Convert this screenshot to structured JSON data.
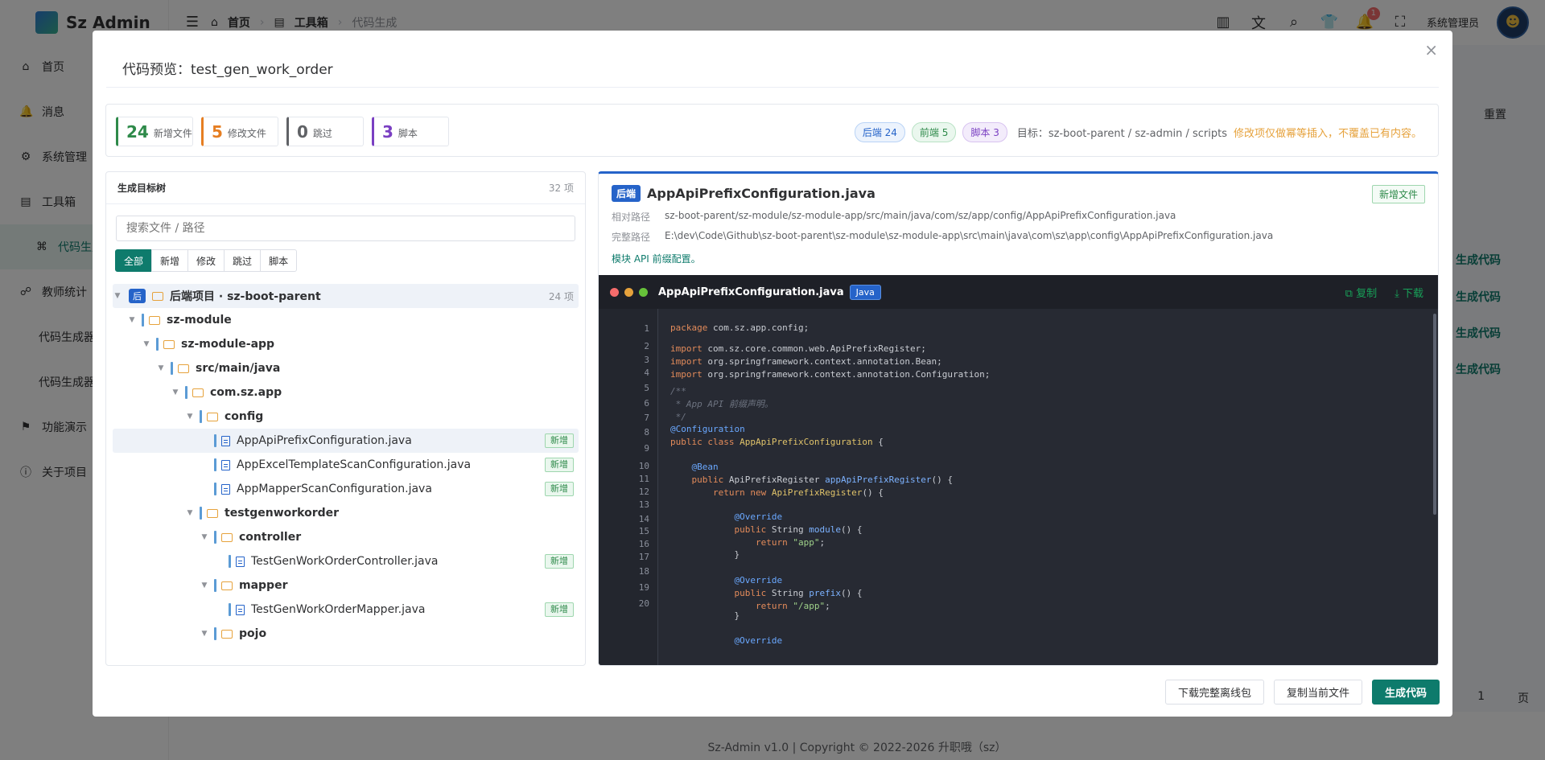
{
  "app": {
    "name": "Sz Admin",
    "menu": [
      {
        "label": "首页",
        "icon": "home-icon"
      },
      {
        "label": "消息",
        "icon": "bell-icon"
      },
      {
        "label": "系统管理",
        "icon": "gear-icon"
      },
      {
        "label": "工具箱",
        "icon": "toolbox-icon"
      },
      {
        "label": "代码生成",
        "icon": "code-icon"
      },
      {
        "label": "教师统计",
        "icon": "chart-icon"
      },
      {
        "label": "代码生成器",
        "icon": ""
      },
      {
        "label": "代码生成器",
        "icon": ""
      },
      {
        "label": "功能演示",
        "icon": "flag-icon"
      },
      {
        "label": "关于项目",
        "icon": "info-icon"
      }
    ],
    "breadcrumb": [
      "首页",
      "工具箱",
      "代码生成"
    ],
    "notice_count": "1",
    "user_name": "系统管理员",
    "bg_reset": "重置",
    "bg_gen_label": "生成代码",
    "bg_page": "1",
    "bg_page_unit": "页",
    "footer": "Sz-Admin v1.0 | Copyright © 2022-2026 升职哦（sz）"
  },
  "dialog": {
    "title": "代码预览：test_gen_work_order",
    "summary": {
      "stats": [
        {
          "num": "24",
          "label": "新增文件",
          "color": "#2e8a4a"
        },
        {
          "num": "5",
          "label": "修改文件",
          "color": "#e67e22"
        },
        {
          "num": "0",
          "label": "跳过",
          "color": "#606266"
        },
        {
          "num": "3",
          "label": "脚本",
          "color": "#7a3fc2"
        }
      ],
      "pill_backend": "后端 24",
      "pill_frontend": "前端 5",
      "pill_script": "脚本 3",
      "target": "目标：sz-boot-parent / sz-admin / scripts",
      "warning": "修改项仅做幂等插入，不覆盖已有内容。"
    },
    "tree": {
      "title": "生成目标树",
      "count": "32 项",
      "search_placeholder": "搜索文件 / 路径",
      "filters": [
        "全部",
        "新增",
        "修改",
        "跳过",
        "脚本"
      ],
      "root_badge": "后",
      "root_label": "后端项目 · sz-boot-parent",
      "root_count": "24 项",
      "nodes": [
        {
          "label": "sz-module",
          "type": "folder",
          "depth": 1,
          "bold": true
        },
        {
          "label": "sz-module-app",
          "type": "folder",
          "depth": 2,
          "bold": true
        },
        {
          "label": "src/main/java",
          "type": "folder",
          "depth": 3,
          "bold": true
        },
        {
          "label": "com.sz.app",
          "type": "folder",
          "depth": 4,
          "bold": true
        },
        {
          "label": "config",
          "type": "folder",
          "depth": 5,
          "bold": true
        },
        {
          "label": "AppApiPrefixConfiguration.java",
          "type": "file",
          "depth": 6,
          "tag": "新增",
          "selected": true
        },
        {
          "label": "AppExcelTemplateScanConfiguration.java",
          "type": "file",
          "depth": 6,
          "tag": "新增"
        },
        {
          "label": "AppMapperScanConfiguration.java",
          "type": "file",
          "depth": 6,
          "tag": "新增"
        },
        {
          "label": "testgenworkorder",
          "type": "folder",
          "depth": 5,
          "bold": true
        },
        {
          "label": "controller",
          "type": "folder",
          "depth": 6,
          "bold": true
        },
        {
          "label": "TestGenWorkOrderController.java",
          "type": "file",
          "depth": 7,
          "tag": "新增"
        },
        {
          "label": "mapper",
          "type": "folder",
          "depth": 6,
          "bold": true
        },
        {
          "label": "TestGenWorkOrderMapper.java",
          "type": "file",
          "depth": 7,
          "tag": "新增"
        },
        {
          "label": "pojo",
          "type": "folder",
          "depth": 6,
          "bold": true
        }
      ]
    },
    "preview": {
      "badge": "后端",
      "file_name": "AppApiPrefixConfiguration.java",
      "status": "新增文件",
      "rel_label": "相对路径",
      "rel_path": "sz-boot-parent/sz-module/sz-module-app/src/main/java/com/sz/app/config/AppApiPrefixConfiguration.java",
      "abs_label": "完整路径",
      "abs_path": "E:\\dev\\Code\\Github\\sz-boot-parent\\sz-module\\sz-module-app\\src\\main\\java\\com\\sz\\app\\config\\AppApiPrefixConfiguration.java",
      "desc": "模块 API 前缀配置。",
      "code_file": "AppApiPrefixConfiguration.java",
      "lang": "Java",
      "copy": "复制",
      "download": "下载",
      "lines": [
        {
          "n": "1",
          "html": "<span class=\"kw\">package</span> com.sz.app.config;"
        },
        {
          "n": "2",
          "html": "<span class=\"kw\">import</span> com.sz.core.common.web.ApiPrefixRegister;"
        },
        {
          "n": "3",
          "html": "<span class=\"kw\">import</span> org.springframework.context.annotation.Bean;"
        },
        {
          "n": "4",
          "html": "<span class=\"kw\">import</span> org.springframework.context.annotation.Configuration;"
        },
        {
          "n": "5",
          "html": "<span class=\"cm\">/**</span>"
        },
        {
          "n": "6",
          "html": "<span class=\"cm\"> * App API 前缀声明。</span>"
        },
        {
          "n": "7",
          "html": "<span class=\"cm\"> */</span>"
        },
        {
          "n": "8",
          "html": "<span class=\"an\">@Configuration</span>"
        },
        {
          "n": "8",
          "html": "<span class=\"kw\">public class</span> <span class=\"ty\">AppApiPrefixConfiguration</span> {"
        },
        {
          "n": "9",
          "html": ""
        },
        {
          "n": "9",
          "html": "    <span class=\"an\">@Bean</span>"
        },
        {
          "n": "10",
          "html": "    <span class=\"kw\">public</span> ApiPrefixRegister <span class=\"fn\">appApiPrefixRegister</span>() {"
        },
        {
          "n": "11",
          "html": "        <span class=\"kw\">return new</span> <span class=\"ty\">ApiPrefixRegister</span>() {"
        },
        {
          "n": "12",
          "html": ""
        },
        {
          "n": "12",
          "html": "            <span class=\"an\">@Override</span>"
        },
        {
          "n": "13",
          "html": "            <span class=\"kw\">public</span> String <span class=\"fn\">module</span>() {"
        },
        {
          "n": "14",
          "html": "                <span class=\"kw\">return</span> <span class=\"st\">\"app\"</span>;"
        },
        {
          "n": "15",
          "html": "            }"
        },
        {
          "n": "16",
          "html": ""
        },
        {
          "n": "16",
          "html": "            <span class=\"an\">@Override</span>"
        },
        {
          "n": "17",
          "html": "            <span class=\"kw\">public</span> String <span class=\"fn\">prefix</span>() {"
        },
        {
          "n": "18",
          "html": "                <span class=\"kw\">return</span> <span class=\"st\">\"/app\"</span>;"
        },
        {
          "n": "18",
          "html": "            }"
        },
        {
          "n": "19",
          "html": ""
        },
        {
          "n": "20",
          "html": "            <span class=\"an\">@Override</span>"
        }
      ]
    },
    "buttons": {
      "download_package": "下载完整离线包",
      "copy_current": "复制当前文件",
      "generate": "生成代码"
    }
  }
}
